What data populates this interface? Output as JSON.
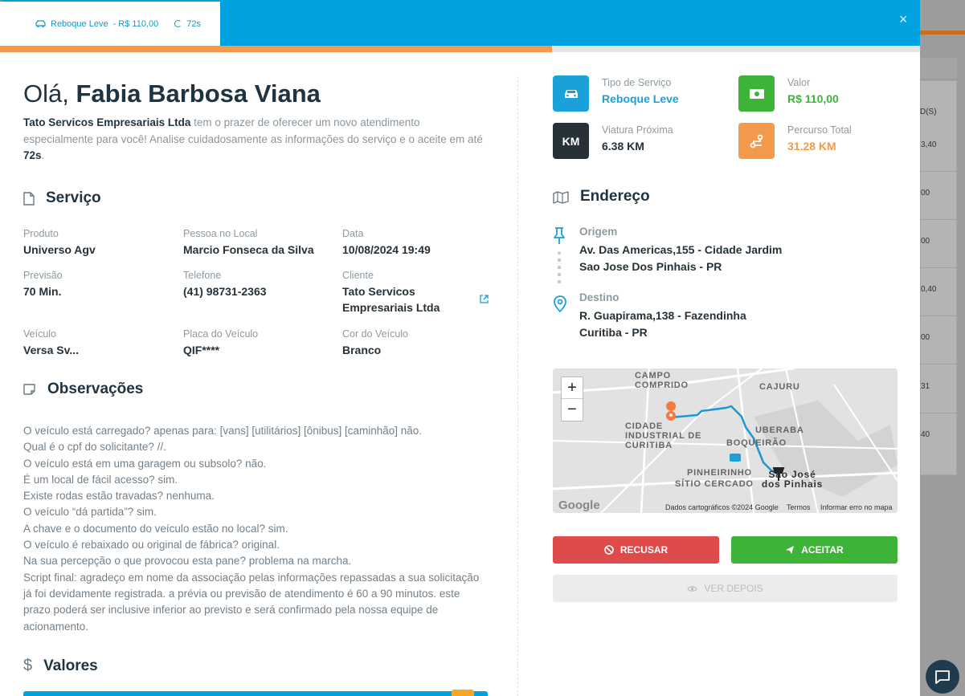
{
  "tab": {
    "service": "Reboque Leve",
    "price": "- R$ 110,00",
    "timer": "72s"
  },
  "close_label": "×",
  "progress_fraction": 0.6,
  "greeting": {
    "prefix": "Olá,",
    "name": "Fabia Barbosa Viana"
  },
  "intro": {
    "company": "Tato Servicos Empresariais Ltda",
    "text": " tem o prazer de oferecer um novo atendimento especialmente para você! Analise cuidadosamente as informações do serviço e o aceite em até ",
    "seconds": "72s",
    "end": "."
  },
  "servico": {
    "title": "Serviço",
    "fields": [
      {
        "label": "Produto",
        "value": "Universo Agv"
      },
      {
        "label": "Pessoa no Local",
        "value": "Marcio Fonseca da Silva"
      },
      {
        "label": "Data",
        "value": "10/08/2024 19:49"
      },
      {
        "label": "Previsão",
        "value": "70 Min."
      },
      {
        "label": "Telefone",
        "value": "(41) 98731-2363"
      },
      {
        "label": "Cliente",
        "value": "Tato Servicos Empresariais Ltda"
      },
      {
        "label": "Veículo",
        "value": "Versa Sv..."
      },
      {
        "label": "Placa do Veículo",
        "value": "QIF****"
      },
      {
        "label": "Cor do Veículo",
        "value": "Branco"
      }
    ]
  },
  "observacoes": {
    "title": "Observações",
    "lines": [
      "O veículo está carregado? apenas para: [vans] [utilitários] [ônibus] [caminhão] não.",
      "Qual é o cpf do solicitante? //.",
      "O veículo está em uma garagem ou subsolo? não.",
      "É um local de fácil acesso? sim.",
      "Existe rodas estão travadas? nenhuma.",
      "O veículo “dá partida”? sim.",
      "A chave e o documento do veículo estão no local? sim.",
      "O veículo é rebaixado ou original de fábrica? original.",
      "Na sua percepção o que provocou esta pane? problema na marcha.",
      "Script final: agradeço em nome da associação pelas informações repassadas a sua solicitação já foi devidamente registrada. a prévia ou previsão de atendimento é 60 a 90 minutos. este prazo poderá ser inclusive inferior ao previsto e será confirmado pela nossa equipe de acionamento."
    ]
  },
  "valores": {
    "title": "Valores",
    "symbol": "$"
  },
  "info": {
    "tipo": {
      "label": "Tipo de Serviço",
      "value": "Reboque Leve",
      "color": "#1aa1d8"
    },
    "valor": {
      "label": "Valor",
      "value": "R$ 110,00",
      "color": "#3db438"
    },
    "viatura": {
      "label": "Viatura Próxima",
      "value": "6.38 KM",
      "icon_text": "KM",
      "color": "#263238"
    },
    "percurso": {
      "label": "Percurso Total",
      "value": "31.28 KM",
      "color": "#f39a4c"
    }
  },
  "endereco": {
    "title": "Endereço",
    "origem": {
      "label": "Origem",
      "line1": "Av. Das Americas,155 - Cidade Jardim",
      "line2": "Sao Jose Dos Pinhais - PR"
    },
    "destino": {
      "label": "Destino",
      "line1": "R. Guapirama,138 - Fazendinha",
      "line2": "Curitiba - PR"
    }
  },
  "map": {
    "zoom_in": "+",
    "zoom_out": "−",
    "labels": [
      "CAMPO COMPRIDO",
      "CAJURU",
      "CIDADE INDUSTRIAL DE CURITIBA",
      "UBERABA",
      "BOQUEIRÃO",
      "PINHEIRINHO",
      "SÍTIO CERCADO",
      "São José dos Pinhais"
    ],
    "google": "Google",
    "footer": {
      "data": "Dados cartográficos ©2024 Google",
      "terms": "Termos",
      "report": "Informar erro no mapa"
    }
  },
  "actions": {
    "recusar": "RECUSAR",
    "aceitar": "ACEITAR",
    "ver_depois": "VER DEPOIS"
  },
  "background": {
    "header": "D(S)",
    "values": [
      "3,40",
      "00",
      "00",
      "0,40",
      "00",
      "31",
      "40"
    ]
  }
}
